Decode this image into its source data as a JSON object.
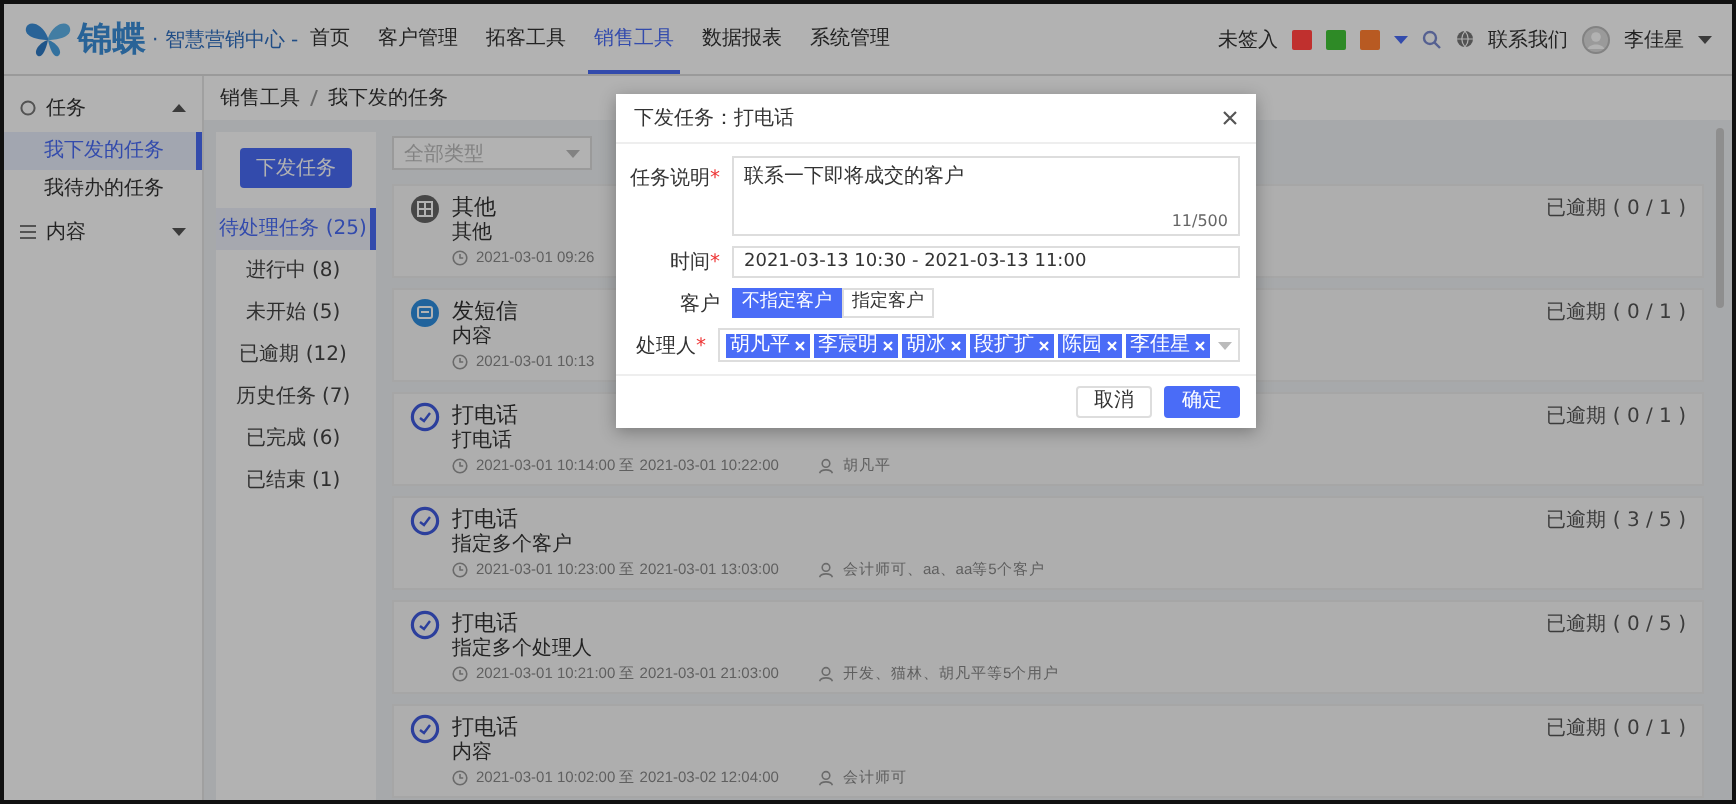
{
  "header": {
    "logo_text": "锦蝶",
    "logo_subtitle": "· 智慧营销中心 -",
    "nav": [
      {
        "label": "首页",
        "selected": false
      },
      {
        "label": "客户管理",
        "selected": false
      },
      {
        "label": "拓客工具",
        "selected": false
      },
      {
        "label": "销售工具",
        "selected": true
      },
      {
        "label": "数据报表",
        "selected": false
      },
      {
        "label": "系统管理",
        "selected": false
      }
    ],
    "checkin": "未签入",
    "status_icons": [
      {
        "color": "#c0302e"
      },
      {
        "color": "#2e8a26"
      },
      {
        "color": "#b85a22"
      }
    ],
    "contact": "联系我们",
    "user": "李佳星"
  },
  "sidebar": {
    "groups": [
      {
        "label": "任务",
        "expanded": true,
        "children": [
          {
            "label": "我下发的任务",
            "selected": true
          },
          {
            "label": "我待办的任务",
            "selected": false
          }
        ]
      },
      {
        "label": "内容",
        "expanded": false
      }
    ]
  },
  "breadcrumb": [
    "销售工具",
    "我下发的任务"
  ],
  "new_task_button": "下发任务",
  "filters": [
    {
      "label": "待处理任务 (25)",
      "selected": true
    },
    {
      "label": "进行中 (8)",
      "selected": false
    },
    {
      "label": "未开始 (5)",
      "selected": false
    },
    {
      "label": "已逾期 (12)",
      "selected": false
    },
    {
      "label": "历史任务 (7)",
      "selected": false
    },
    {
      "label": "已完成 (6)",
      "selected": false
    },
    {
      "label": "已结束 (1)",
      "selected": false
    }
  ],
  "type_select": {
    "placeholder": "全部类型"
  },
  "tasks": [
    {
      "kind": "other",
      "title": "其他",
      "description": "其他",
      "time": "2021-03-01 09:26",
      "status": "已逾期 ( 0 / 1 )"
    },
    {
      "kind": "sms",
      "title": "发短信",
      "description": "内容",
      "time": "2021-03-01 10:13",
      "status": "已逾期 ( 0 / 1 )"
    },
    {
      "kind": "call",
      "title": "打电话",
      "description": "打电话",
      "time": "2021-03-01 10:14:00 至 2021-03-01 10:22:00",
      "assignee": "胡凡平",
      "status": "已逾期 ( 0 / 1 )"
    },
    {
      "kind": "call",
      "title": "打电话",
      "description": "指定多个客户",
      "time": "2021-03-01 10:23:00 至 2021-03-01 13:03:00",
      "assignee": "会计师可、aa、aa等5个客户",
      "status": "已逾期 ( 3 / 5 )"
    },
    {
      "kind": "call",
      "title": "打电话",
      "description": "指定多个处理人",
      "time": "2021-03-01 10:21:00 至 2021-03-01 21:03:00",
      "assignee": "开发、猫林、胡凡平等5个用户",
      "status": "已逾期 ( 0 / 5 )"
    },
    {
      "kind": "call",
      "title": "打电话",
      "description": "内容",
      "time": "2021-03-01 10:02:00 至 2021-03-02 12:04:00",
      "assignee": "会计师可",
      "status": "已逾期 ( 0 / 1 )"
    }
  ],
  "modal": {
    "title": "下发任务：打电话",
    "description": {
      "label": "任务说明",
      "mark": "*",
      "value": "联系一下即将成交的客户",
      "counter": "11/500"
    },
    "time": {
      "label": "时间",
      "mark": "*",
      "value": "2021-03-13 10:30 - 2021-03-13 11:00"
    },
    "customer": {
      "label": "客户",
      "options": [
        {
          "label": "不指定客户",
          "selected": true
        },
        {
          "label": "指定客户",
          "selected": false
        }
      ]
    },
    "handlers": {
      "label": "处理人",
      "mark": "*",
      "tags": [
        "胡凡平",
        "李宸明",
        "胡冰",
        "段扩扩",
        "陈园",
        "李佳星"
      ]
    },
    "buttons": [
      {
        "label": "取消",
        "kind": "secondary"
      },
      {
        "label": "确定",
        "kind": "primary"
      }
    ]
  }
}
